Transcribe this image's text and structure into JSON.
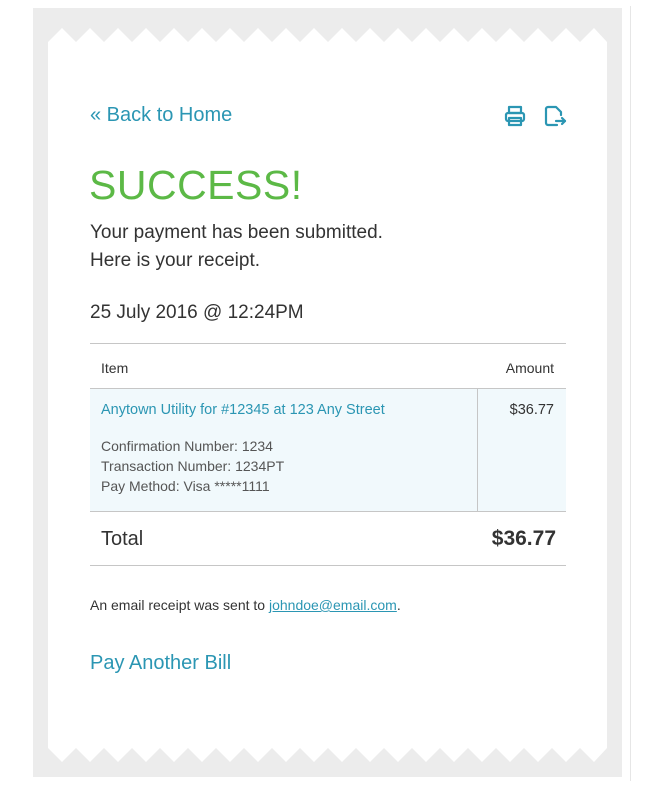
{
  "nav": {
    "back_label": "« Back to Home"
  },
  "toolbar": {
    "print_icon": "printer-icon",
    "export_icon": "export-icon"
  },
  "status": {
    "title": "SUCCESS!"
  },
  "message": {
    "line1": "Your payment has been submitted.",
    "line2": "Here is your receipt."
  },
  "receipt": {
    "datetime": "25 July 2016 @ 12:24PM",
    "columns": [
      "Item",
      "Amount"
    ],
    "items": [
      {
        "title": "Anytown Utility for #12345 at 123 Any Street",
        "details": [
          "Confirmation Number: 1234",
          "Transaction Number: 1234PT",
          "Pay Method: Visa *****1111"
        ],
        "amount": "$36.77"
      }
    ],
    "total_label": "Total",
    "total_value": "$36.77"
  },
  "footer": {
    "email_prefix": "An email receipt was sent to ",
    "email_address": "johndoe@email.com",
    "email_suffix": ".",
    "pay_another_label": "Pay Another Bill"
  },
  "colors": {
    "accent": "#2b96b3",
    "success": "#5cb946",
    "row_highlight": "#f1f9fc"
  }
}
